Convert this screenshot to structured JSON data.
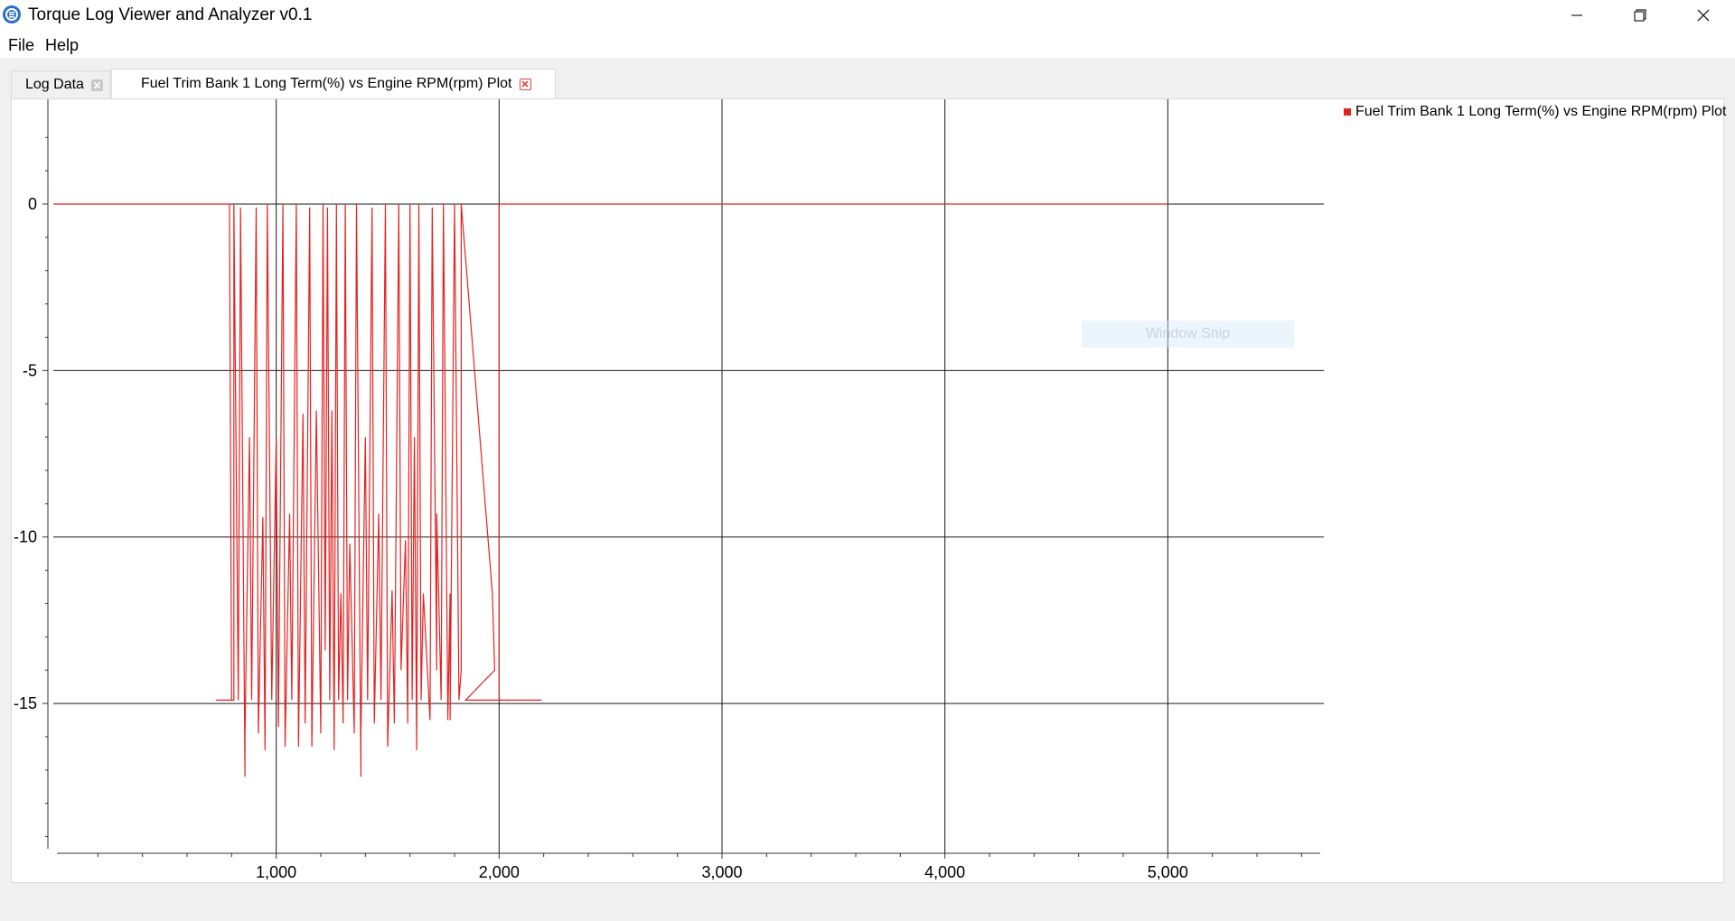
{
  "window": {
    "title": "Torque Log Viewer and Analyzer v0.1",
    "icon": "torque-app-icon",
    "controls": [
      "minimize-icon",
      "restore-icon",
      "close-icon"
    ]
  },
  "menu": [
    "File",
    "Help"
  ],
  "tabs": [
    {
      "label": "Log Data",
      "active": false,
      "close_icon": "close-icon"
    },
    {
      "label": "Fuel Trim Bank 1 Long Term(%) vs Engine RPM(rpm) Plot",
      "active": true,
      "close_icon": "close-icon"
    }
  ],
  "overlay": {
    "label": "Window Snip"
  },
  "chart_data": {
    "type": "line",
    "title": "",
    "xlabel": "",
    "ylabel": "",
    "xlim": [
      0,
      5700
    ],
    "ylim": [
      -19.5,
      3.2
    ],
    "x_ticks": [
      1000,
      2000,
      3000,
      4000,
      5000
    ],
    "x_tick_labels": [
      "1,000",
      "2,000",
      "3,000",
      "4,000",
      "5,000"
    ],
    "y_ticks": [
      0,
      -5,
      -10,
      -15
    ],
    "y_tick_labels": [
      "0",
      "-5",
      "-10",
      "-15"
    ],
    "grid": true,
    "legend_position": "right",
    "series_color": "#e52222",
    "series": [
      {
        "name": "Fuel Trim Bank 1 Long Term(%) vs Engine RPM(rpm) Plot",
        "points": [
          [
            0,
            0
          ],
          [
            790,
            0
          ],
          [
            800,
            -14.9
          ],
          [
            730,
            -14.9
          ],
          [
            810,
            -14.9
          ],
          [
            810,
            0
          ],
          [
            830,
            -14.9
          ],
          [
            840,
            -0.1
          ],
          [
            860,
            -17.2
          ],
          [
            860,
            -15.9
          ],
          [
            880,
            -7.0
          ],
          [
            890,
            -14.9
          ],
          [
            910,
            -0.1
          ],
          [
            920,
            -15.9
          ],
          [
            940,
            -9.4
          ],
          [
            950,
            -16.4
          ],
          [
            960,
            0
          ],
          [
            980,
            -14.9
          ],
          [
            1000,
            -7.0
          ],
          [
            1010,
            -15.7
          ],
          [
            1030,
            0
          ],
          [
            1040,
            -16.3
          ],
          [
            1060,
            -9.3
          ],
          [
            1070,
            -14.9
          ],
          [
            1090,
            0
          ],
          [
            1100,
            -16.3
          ],
          [
            1120,
            -6.3
          ],
          [
            1130,
            -15.6
          ],
          [
            1150,
            -0.1
          ],
          [
            1160,
            -16.3
          ],
          [
            1180,
            -6.2
          ],
          [
            1200,
            -15.9
          ],
          [
            1210,
            0
          ],
          [
            1220,
            -13.4
          ],
          [
            1230,
            -0.1
          ],
          [
            1240,
            -14.9
          ],
          [
            1250,
            -6.2
          ],
          [
            1260,
            -16.4
          ],
          [
            1270,
            0
          ],
          [
            1280,
            -14.9
          ],
          [
            1290,
            -11.7
          ],
          [
            1300,
            -15.6
          ],
          [
            1310,
            0
          ],
          [
            1320,
            -14.9
          ],
          [
            1330,
            -10.2
          ],
          [
            1350,
            -15.9
          ],
          [
            1360,
            0
          ],
          [
            1380,
            -17.2
          ],
          [
            1380,
            -15.9
          ],
          [
            1400,
            -7.0
          ],
          [
            1410,
            -14.9
          ],
          [
            1430,
            -0.1
          ],
          [
            1440,
            -15.6
          ],
          [
            1460,
            -9.3
          ],
          [
            1470,
            -14.9
          ],
          [
            1490,
            0
          ],
          [
            1500,
            -16.3
          ],
          [
            1520,
            -11.6
          ],
          [
            1530,
            -15.6
          ],
          [
            1550,
            0
          ],
          [
            1560,
            -14.0
          ],
          [
            1580,
            -10.1
          ],
          [
            1590,
            -15.6
          ],
          [
            1600,
            0
          ],
          [
            1610,
            -14.9
          ],
          [
            1620,
            -7.0
          ],
          [
            1630,
            -16.4
          ],
          [
            1640,
            0
          ],
          [
            1650,
            -14.9
          ],
          [
            1660,
            -11.7
          ],
          [
            1690,
            -15.5
          ],
          [
            1700,
            -0.1
          ],
          [
            1720,
            -14.0
          ],
          [
            1720,
            -9.3
          ],
          [
            1740,
            -14.9
          ],
          [
            1750,
            0
          ],
          [
            1770,
            -15.5
          ],
          [
            1780,
            -11.7
          ],
          [
            1780,
            -15.5
          ],
          [
            1800,
            0
          ],
          [
            1820,
            -14.9
          ],
          [
            1830,
            -14.0
          ],
          [
            1830,
            0
          ],
          [
            1970,
            -11.7
          ],
          [
            1980,
            -14.0
          ],
          [
            1850,
            -14.9
          ],
          [
            2000,
            -14.9
          ],
          [
            2190,
            -14.9
          ],
          [
            2000,
            -14.9
          ],
          [
            2000,
            0
          ],
          [
            5000,
            0
          ]
        ]
      }
    ]
  }
}
